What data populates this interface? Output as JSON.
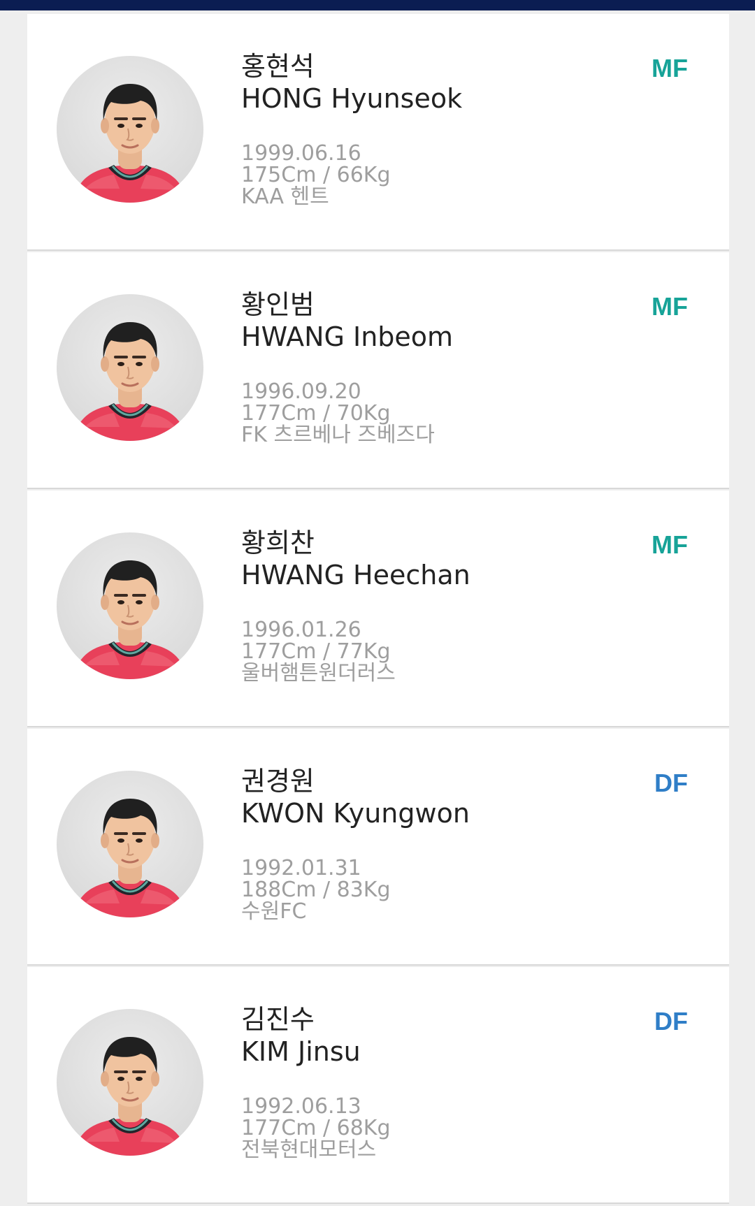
{
  "colors": {
    "mf": "#17a398",
    "df": "#2f7ec7",
    "header": "#0b1d52"
  },
  "players": [
    {
      "name_ko": "홍현석",
      "name_en": "HONG Hyunseok",
      "position": "MF",
      "birth": "1999.06.16",
      "body": "175Cm / 66Kg",
      "club": "KAA 헨트",
      "photo_icon": "player-portrait-icon"
    },
    {
      "name_ko": "황인범",
      "name_en": "HWANG Inbeom",
      "position": "MF",
      "birth": "1996.09.20",
      "body": "177Cm / 70Kg",
      "club": "FK 츠르베나 즈베즈다",
      "photo_icon": "player-portrait-icon"
    },
    {
      "name_ko": "황희찬",
      "name_en": "HWANG Heechan",
      "position": "MF",
      "birth": "1996.01.26",
      "body": "177Cm / 77Kg",
      "club": "울버햄튼원더러스",
      "photo_icon": "player-portrait-icon"
    },
    {
      "name_ko": "권경원",
      "name_en": "KWON Kyungwon",
      "position": "DF",
      "birth": "1992.01.31",
      "body": "188Cm / 83Kg",
      "club": "수원FC",
      "photo_icon": "player-portrait-icon"
    },
    {
      "name_ko": "김진수",
      "name_en": "KIM Jinsu",
      "position": "DF",
      "birth": "1992.06.13",
      "body": "177Cm / 68Kg",
      "club": "전북현대모터스",
      "photo_icon": "player-portrait-icon"
    }
  ]
}
